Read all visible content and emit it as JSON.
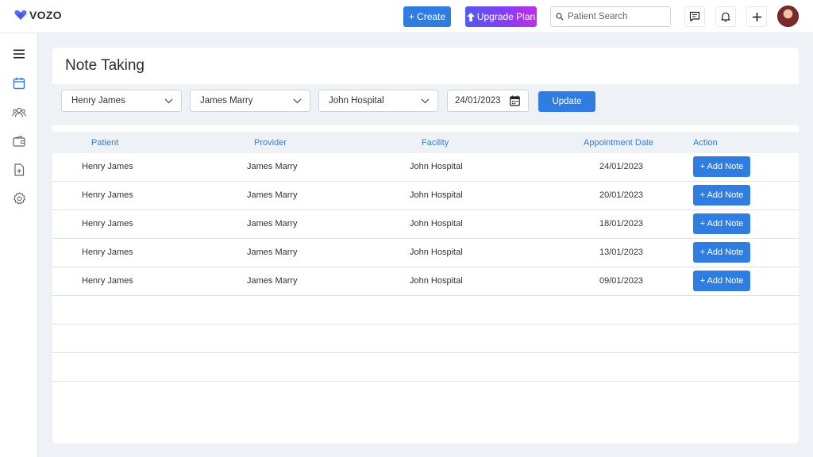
{
  "app": {
    "name": "VOZO"
  },
  "header": {
    "create_label": "+ Create",
    "upgrade_label": "Upgrade Plan",
    "search_placeholder": "Patient Search"
  },
  "sidebar": {
    "items": [
      {
        "icon": "menu-icon"
      },
      {
        "icon": "calendar-icon"
      },
      {
        "icon": "users-icon"
      },
      {
        "icon": "wallet-icon"
      },
      {
        "icon": "document-add-icon"
      },
      {
        "icon": "gear-icon"
      }
    ]
  },
  "page": {
    "title": "Note Taking"
  },
  "filters": {
    "patient": "Henry James",
    "provider": "James Marry",
    "facility": "John Hospital",
    "date": "24/01/2023",
    "update_label": "Update"
  },
  "table": {
    "columns": [
      "Patient",
      "Provider",
      "Facility",
      "Appointment Date",
      "Action"
    ],
    "add_note_label": "+ Add  Note",
    "rows": [
      {
        "patient": "Henry James",
        "provider": "James Marry",
        "facility": "John Hospital",
        "date": "24/01/2023"
      },
      {
        "patient": "Henry James",
        "provider": "James Marry",
        "facility": "John Hospital",
        "date": "20/01/2023"
      },
      {
        "patient": "Henry James",
        "provider": "James Marry",
        "facility": "John Hospital",
        "date": "18/01/2023"
      },
      {
        "patient": "Henry James",
        "provider": "James Marry",
        "facility": "John Hospital",
        "date": "13/01/2023"
      },
      {
        "patient": "Henry James",
        "provider": "James Marry",
        "facility": "John Hospital",
        "date": "09/01/2023"
      }
    ]
  },
  "colors": {
    "accent": "#2f7de1",
    "upgrade_start": "#4f5bf0",
    "upgrade_end": "#c12ee8",
    "background": "#eef1f5"
  }
}
